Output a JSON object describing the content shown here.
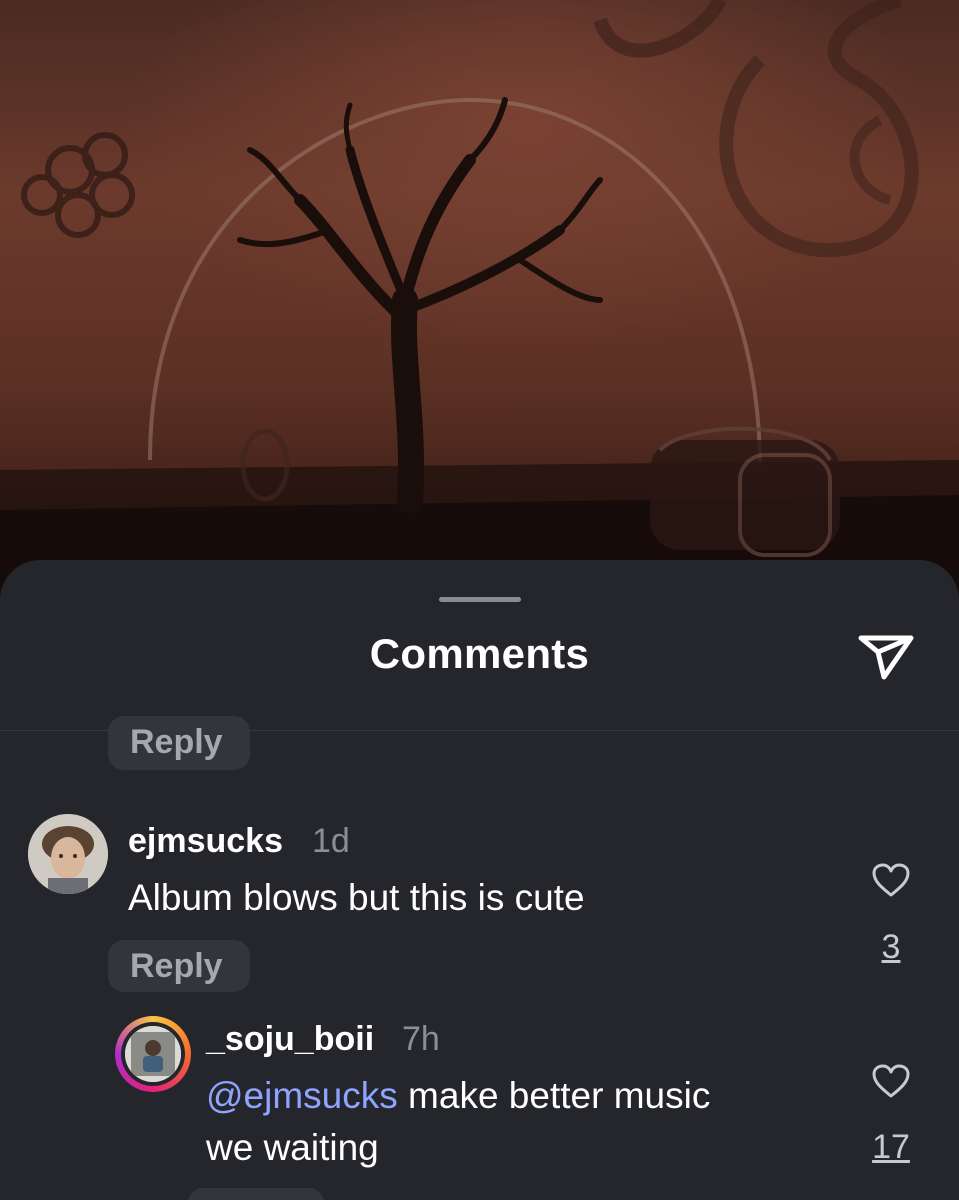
{
  "sheet": {
    "title": "Comments",
    "share_icon": "paper-plane-icon"
  },
  "comments": [
    {
      "username": "ejmsucks",
      "time": "1d",
      "text": "Album blows but this is cute",
      "reply_label": "Reply",
      "likes": "3",
      "avatar": "profile-photo"
    },
    {
      "username": "_soju_boii",
      "time": "7h",
      "mention": "@ejmsucks",
      "text_line1": " make better music",
      "text_line2": "we waiting",
      "likes": "17",
      "avatar": "profile-photo-with-story-ring"
    }
  ],
  "partial_reply_label": "Reply",
  "colors": {
    "sheet_bg": "#25262b",
    "mention": "#8fa4ff",
    "pill_bg": "#34353a"
  }
}
